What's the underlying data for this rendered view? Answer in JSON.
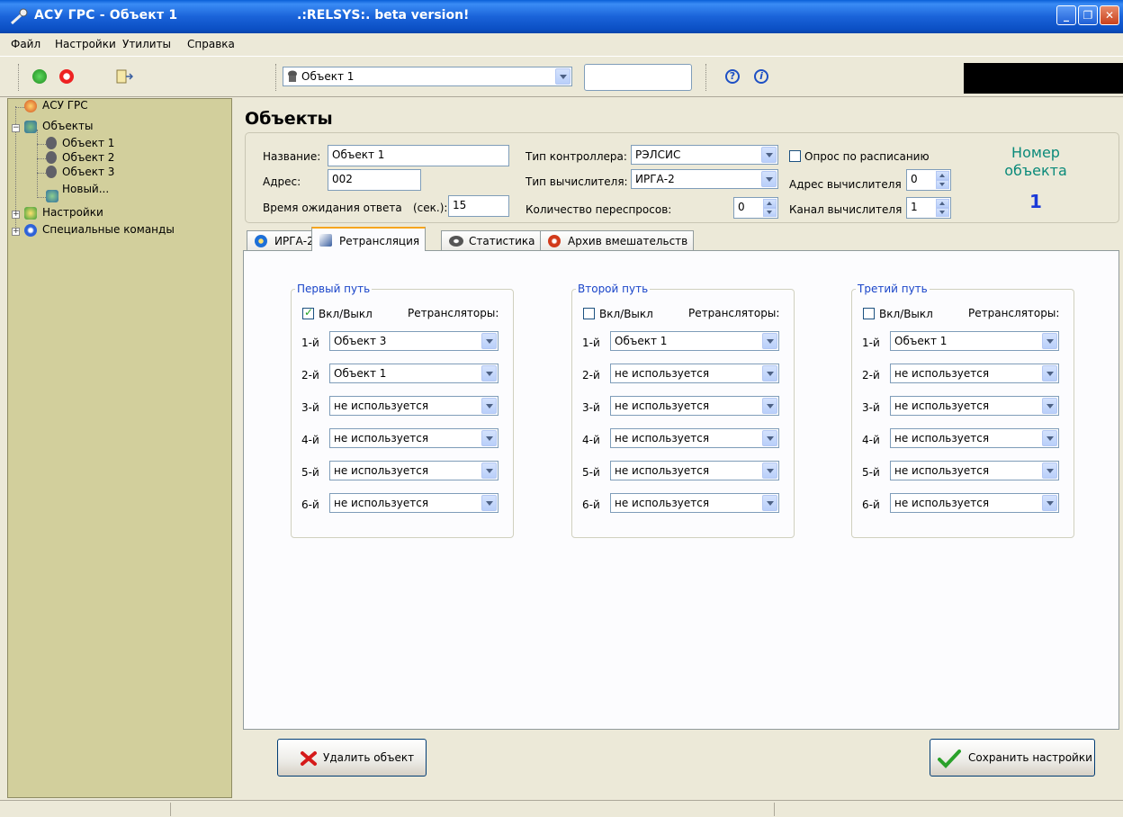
{
  "window": {
    "title": "АСУ ГРС - Объект 1",
    "subtitle": ".:RELSYS:. beta version!"
  },
  "menu": [
    "Файл",
    "Настройки",
    "Утилиты",
    "Справка"
  ],
  "toolbar": {
    "object_selector": "Объект 1",
    "search_value": ""
  },
  "tree": {
    "root": "АСУ ГРС",
    "objects_label": "Объекты",
    "objects": [
      "Объект 1",
      "Объект 2",
      "Объект 3"
    ],
    "new_label": "Новый...",
    "settings_label": "Настройки",
    "special_label": "Специальные команды"
  },
  "main": {
    "title": "Объекты",
    "props": {
      "name_label": "Название:",
      "name_value": "Объект 1",
      "address_label": "Адрес:",
      "address_value": "002",
      "timeout_label": "Время ожидания ответа",
      "timeout_unit": "(сек.):",
      "timeout_value": "15",
      "controller_label": "Тип контроллера:",
      "controller_value": "РЭЛСИС",
      "calc_label": "Тип вычислителя:",
      "calc_value": "ИРГА-2",
      "retries_label": "Количество переспросов:",
      "retries_value": "0",
      "schedule_label": "Опрос по расписанию",
      "calc_addr_label": "Адрес вычислителя",
      "calc_addr_value": "0",
      "calc_channel_label": "Канал вычислителя",
      "calc_channel_value": "1",
      "objnum_label": "Номер объекта",
      "objnum_value": "1"
    },
    "tabs": [
      "ИРГА-2",
      "Ретрансляция",
      "Статистика",
      "Архив вмешательств"
    ],
    "paths": [
      {
        "legend": "Первый путь",
        "enabled_label": "Вкл/Выкл",
        "enabled": true,
        "repeaters_label": "Ретрансляторы:",
        "rows": [
          {
            "label": "1-й",
            "value": "Объект 3"
          },
          {
            "label": "2-й",
            "value": "Объект 1"
          },
          {
            "label": "3-й",
            "value": "не используется"
          },
          {
            "label": "4-й",
            "value": "не используется"
          },
          {
            "label": "5-й",
            "value": "не используется"
          },
          {
            "label": "6-й",
            "value": "не используется"
          }
        ]
      },
      {
        "legend": "Второй путь",
        "enabled_label": "Вкл/Выкл",
        "enabled": false,
        "repeaters_label": "Ретрансляторы:",
        "rows": [
          {
            "label": "1-й",
            "value": "Объект 1"
          },
          {
            "label": "2-й",
            "value": "не используется"
          },
          {
            "label": "3-й",
            "value": "не используется"
          },
          {
            "label": "4-й",
            "value": "не используется"
          },
          {
            "label": "5-й",
            "value": "не используется"
          },
          {
            "label": "6-й",
            "value": "не используется"
          }
        ]
      },
      {
        "legend": "Третий путь",
        "enabled_label": "Вкл/Выкл",
        "enabled": false,
        "repeaters_label": "Ретрансляторы:",
        "rows": [
          {
            "label": "1-й",
            "value": "Объект 1"
          },
          {
            "label": "2-й",
            "value": "не используется"
          },
          {
            "label": "3-й",
            "value": "не используется"
          },
          {
            "label": "4-й",
            "value": "не используется"
          },
          {
            "label": "5-й",
            "value": "не используется"
          },
          {
            "label": "6-й",
            "value": "не используется"
          }
        ]
      }
    ],
    "delete_button": "Удалить объект",
    "save_button": "Сохранить настройки"
  },
  "colors": {
    "titlebar": "#1a63d9",
    "sidebar": "#d2cf9c",
    "accent_number": "#1a3ad8",
    "legend": "#1a45c9"
  }
}
